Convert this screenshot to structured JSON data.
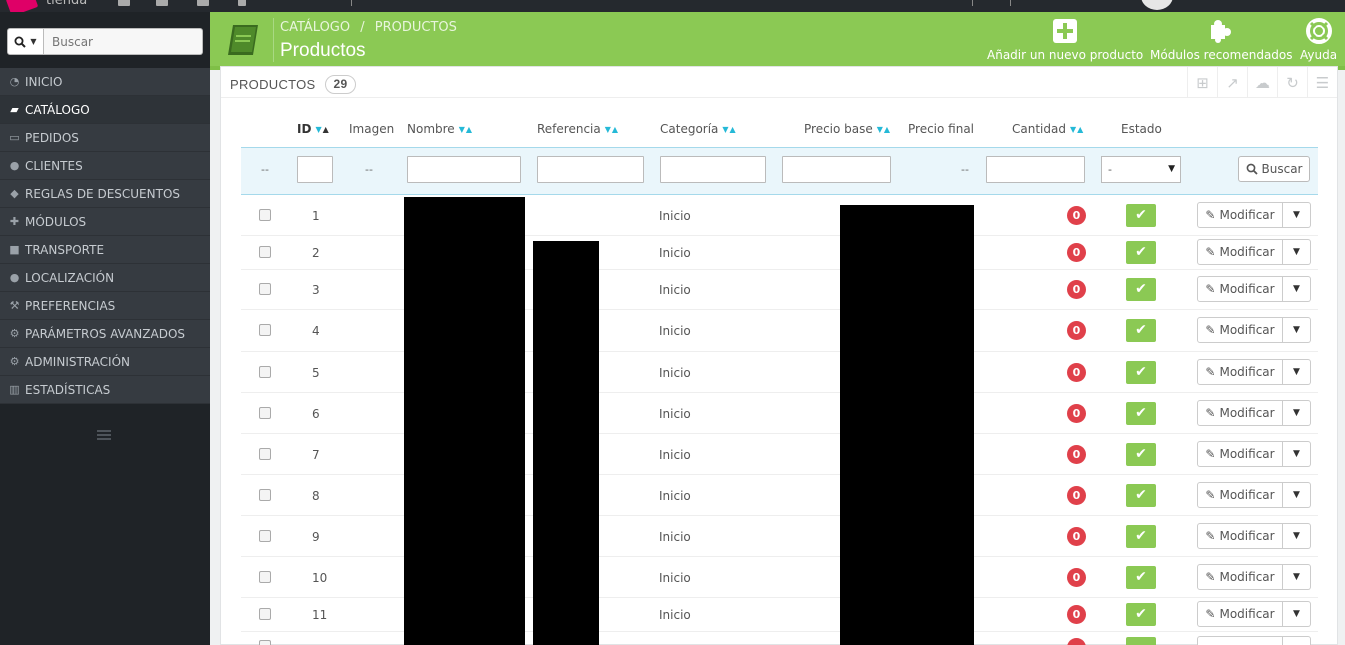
{
  "topbar": {
    "shop_name": "tienda"
  },
  "sidebar": {
    "search_placeholder": "Buscar",
    "items": [
      {
        "label": "INICIO",
        "icon": "dashboard-icon"
      },
      {
        "label": "CATÁLOGO",
        "icon": "book-icon",
        "active": true
      },
      {
        "label": "PEDIDOS",
        "icon": "credit-card-icon"
      },
      {
        "label": "CLIENTES",
        "icon": "users-icon"
      },
      {
        "label": "REGLAS DE DESCUENTOS",
        "icon": "tags-icon"
      },
      {
        "label": "MÓDULOS",
        "icon": "puzzle-icon"
      },
      {
        "label": "TRANSPORTE",
        "icon": "truck-icon"
      },
      {
        "label": "LOCALIZACIÓN",
        "icon": "globe-icon"
      },
      {
        "label": "PREFERENCIAS",
        "icon": "wrench-icon"
      },
      {
        "label": "PARÁMETROS AVANZADOS",
        "icon": "cogs-icon"
      },
      {
        "label": "ADMINISTRACIÓN",
        "icon": "cog-icon"
      },
      {
        "label": "ESTADÍSTICAS",
        "icon": "bar-chart-icon"
      }
    ]
  },
  "header": {
    "breadcrumb": [
      "CATÁLOGO",
      "/",
      "PRODUCTOS"
    ],
    "title": "Productos",
    "buttons": {
      "add": "Añadir un nuevo producto",
      "modules": "Módulos recomendados",
      "help": "Ayuda"
    }
  },
  "panel": {
    "title": "PRODUCTOS",
    "count": "29"
  },
  "table": {
    "headers": {
      "id": "ID",
      "image": "Imagen",
      "name": "Nombre",
      "reference": "Referencia",
      "category": "Categoría",
      "base_price": "Precio base",
      "final_price": "Precio final",
      "quantity": "Cantidad",
      "status": "Estado"
    },
    "filter": {
      "dash": "--",
      "status_value": "-",
      "search_label": "Buscar"
    },
    "row_action": "Modificar",
    "rows": [
      {
        "id": "1",
        "category": "Inicio",
        "quantity": "0"
      },
      {
        "id": "2",
        "category": "Inicio",
        "quantity": "0"
      },
      {
        "id": "3",
        "category": "Inicio",
        "quantity": "0"
      },
      {
        "id": "4",
        "category": "Inicio",
        "quantity": "0"
      },
      {
        "id": "5",
        "category": "Inicio",
        "quantity": "0"
      },
      {
        "id": "6",
        "category": "Inicio",
        "quantity": "0"
      },
      {
        "id": "7",
        "category": "Inicio",
        "quantity": "0"
      },
      {
        "id": "8",
        "category": "Inicio",
        "quantity": "0"
      },
      {
        "id": "9",
        "category": "Inicio",
        "quantity": "0"
      },
      {
        "id": "10",
        "category": "Inicio",
        "quantity": "0"
      },
      {
        "id": "11",
        "category": "Inicio",
        "quantity": "0"
      }
    ]
  },
  "colors": {
    "header_green": "#8bc954",
    "sidebar_dark": "#363b41",
    "qty_red": "#e0404a",
    "accent_blue": "#25b9d7"
  }
}
